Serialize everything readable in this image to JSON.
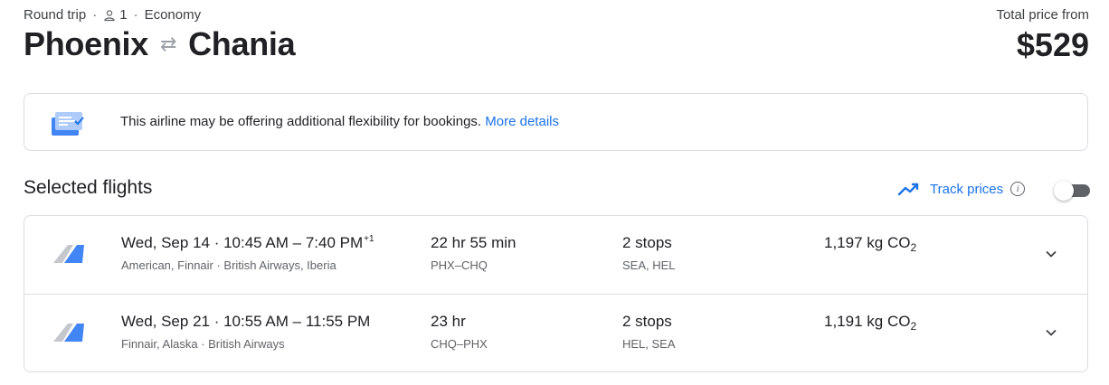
{
  "header": {
    "trip_type": "Round trip",
    "passengers": "1",
    "cabin": "Economy",
    "origin": "Phoenix",
    "destination": "Chania",
    "price_label": "Total price from",
    "price": "$529"
  },
  "banner": {
    "message": "This airline may be offering additional flexibility for bookings.",
    "link": "More details"
  },
  "section": {
    "title": "Selected flights",
    "track_label": "Track prices",
    "track_enabled": false
  },
  "flights": [
    {
      "date": "Wed, Sep 14",
      "times": "10:45 AM – 7:40 PM",
      "day_offset": "+1",
      "airlines": "American, Finnair · British Airways, Iberia",
      "duration": "22 hr 55 min",
      "route": "PHX–CHQ",
      "stops": "2 stops",
      "stop_airports": "SEA, HEL",
      "co2_value": "1,197 kg CO",
      "co2_sub": "2"
    },
    {
      "date": "Wed, Sep 21",
      "times": "10:55 AM – 11:55 PM",
      "day_offset": "",
      "airlines": "Finnair, Alaska · British Airways",
      "duration": "23 hr",
      "route": "CHQ–PHX",
      "stops": "2 stops",
      "stop_airports": "HEL, SEA",
      "co2_value": "1,191 kg CO",
      "co2_sub": "2"
    }
  ],
  "colors": {
    "accent": "#1a73e8",
    "muted": "#5f6368",
    "border": "#dadce0"
  }
}
